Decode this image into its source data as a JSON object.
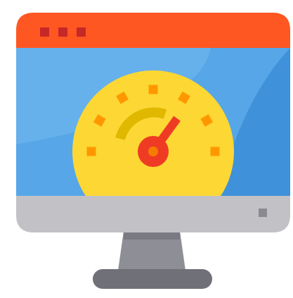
{
  "illustration": {
    "subject": "computer-monitor-speed-test-icon",
    "colors": {
      "titlebar": "#ff5722",
      "titlebar_dots": "#c62828",
      "screen": "#56a6e8",
      "screen_highlight": "#66b0ec",
      "screen_corner": "#3f91d9",
      "gauge_face": "#fdd734",
      "gauge_ticks": "#ff9800",
      "gauge_arc": "#e0b800",
      "needle": "#ef3b24",
      "hub_center": "#f57c00",
      "bezel": "#c2c2c6",
      "power_indicator": "#8a8a90",
      "stand_neck": "#8e8e96",
      "stand_neck_shadow": "#7a7a82",
      "stand_base": "#707078"
    },
    "gauge": {
      "needle_level": 0.7
    }
  }
}
